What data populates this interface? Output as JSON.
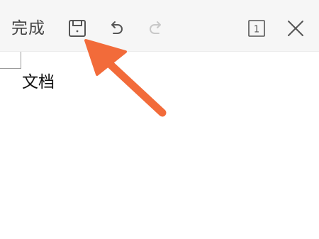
{
  "toolbar": {
    "done_label": "完成",
    "save_icon": "save-icon",
    "undo_icon": "undo-icon",
    "redo_icon": "redo-icon",
    "page_count": "1",
    "close_icon": "close-icon",
    "icon_color": "#555555",
    "disabled_color": "#c8c8c8"
  },
  "document": {
    "body_text": "文档"
  },
  "annotation": {
    "type": "arrow",
    "color": "#f26b3a",
    "points_to": "save-button"
  }
}
